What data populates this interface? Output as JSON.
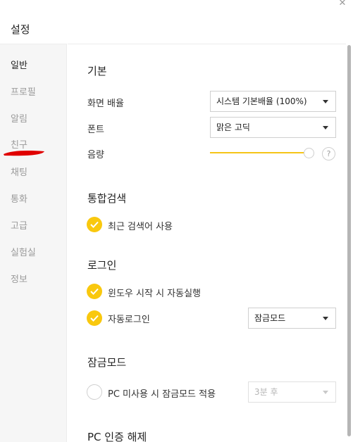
{
  "window": {
    "title": "설정",
    "close_glyph": "✕"
  },
  "sidebar": {
    "items": [
      {
        "label": "일반",
        "active": true
      },
      {
        "label": "프로필"
      },
      {
        "label": "알림"
      },
      {
        "label": "친구"
      },
      {
        "label": "채팅"
      },
      {
        "label": "통화"
      },
      {
        "label": "고급"
      },
      {
        "label": "실험실"
      },
      {
        "label": "정보"
      }
    ]
  },
  "basic": {
    "title": "기본",
    "zoom_label": "화면 배율",
    "zoom_value": "시스템 기본배율 (100%)",
    "font_label": "폰트",
    "font_value": "맑은 고딕",
    "volume_label": "음량",
    "volume_level": 1.0,
    "help_glyph": "?"
  },
  "search": {
    "title": "통합검색",
    "recent_label": "최근 검색어 사용",
    "recent_checked": true
  },
  "login": {
    "title": "로그인",
    "autostart_label": "윈도우 시작 시 자동실행",
    "autostart_checked": true,
    "autologin_label": "자동로그인",
    "autologin_checked": true,
    "autologin_mode": "잠금모드"
  },
  "lock": {
    "title": "잠금모드",
    "idle_label": "PC 미사용 시 잠금모드 적용",
    "idle_checked": false,
    "idle_time": "3분 후"
  },
  "pc_auth": {
    "title": "PC 인증 해제"
  },
  "colors": {
    "accent": "#f9c80e",
    "sidebar_bg": "#f6f6f6"
  }
}
